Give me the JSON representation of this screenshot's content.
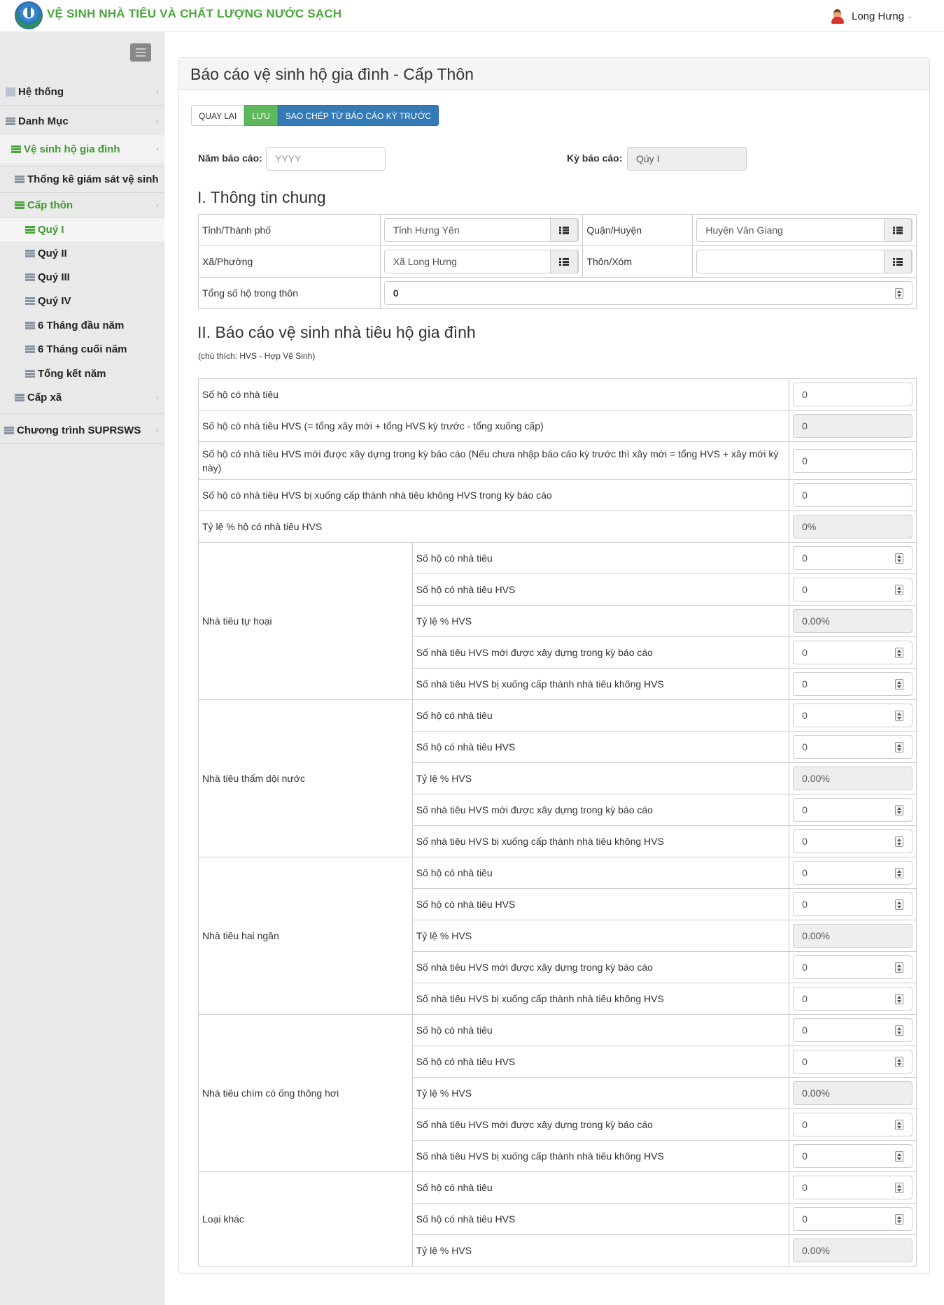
{
  "brand": {
    "title": "VỆ SINH NHÀ TIÊU VÀ CHẤT LƯỢNG NƯỚC SẠCH"
  },
  "user": {
    "name": "Long Hưng"
  },
  "sidebar": {
    "items": [
      {
        "label": "Hệ thống"
      },
      {
        "label": "Danh Mục"
      },
      {
        "label": "Vệ sinh hộ gia đình"
      },
      {
        "label": "Thống kê giám sát vệ sinh"
      },
      {
        "label": "Cấp thôn"
      },
      {
        "label": "Quý I"
      },
      {
        "label": "Quý II"
      },
      {
        "label": "Quý III"
      },
      {
        "label": "Quý IV"
      },
      {
        "label": "6 Tháng đầu năm"
      },
      {
        "label": "6 Tháng cuối năm"
      },
      {
        "label": "Tổng kết năm"
      },
      {
        "label": "Cấp xã"
      },
      {
        "label": "Chương trình SUPRSWS"
      }
    ]
  },
  "page": {
    "title": "Báo cáo vệ sinh hộ gia đình - Cấp Thôn"
  },
  "toolbar": {
    "back": "QUAY LẠI",
    "save": "LƯU",
    "copy": "SAO CHÉP TỪ BÁO CÁO KỲ TRƯỚC"
  },
  "form": {
    "year_label": "Năm báo cáo:",
    "year_placeholder": "YYYY",
    "period_label": "Kỳ báo cáo:",
    "period_value": "Qúy I"
  },
  "section1": {
    "title": "I. Thông tin chung",
    "province_label": "Tỉnh/Thành phố",
    "province_value": "Tỉnh Hưng Yên",
    "district_label": "Quận/Huyện",
    "district_value": "Huyện Văn Giang",
    "commune_label": "Xã/Phường",
    "commune_value": "Xã Long Hưng",
    "village_label": "Thôn/Xóm",
    "village_value": "",
    "households_label": "Tổng số hộ trong thôn",
    "households_value": "0"
  },
  "section2": {
    "title": "II. Báo cáo vệ sinh nhà tiêu hộ gia đình",
    "note": "(chú thích: HVS - Hợp Vệ Sinh)",
    "summary": [
      {
        "label": "Số hộ có nhà tiêu",
        "value": "0"
      },
      {
        "label": "Số hộ có nhà tiêu HVS (= tổng xây mới + tổng HVS kỳ trước - tổng xuống cấp)",
        "value": "0"
      },
      {
        "label": "Số hộ có nhà tiêu HVS mới được xây dựng trong kỳ báo cáo (Nếu chưa nhập báo cáo kỳ trước thì xây mới = tổng HVS + xây mới kỳ này)",
        "value": "0"
      },
      {
        "label": "Số hộ có nhà tiêu HVS bị xuống cấp thành nhà tiêu không HVS trong kỳ báo cáo",
        "value": "0"
      },
      {
        "label": "Tỷ lệ % hộ có nhà tiêu HVS",
        "value": "0%"
      }
    ],
    "groups": [
      {
        "name": "Nhà tiêu tự hoại",
        "rows": [
          {
            "label": "Số hộ có nhà tiêu",
            "value": "0"
          },
          {
            "label": "Số hộ có nhà tiêu HVS",
            "value": "0"
          },
          {
            "label": "Tỷ lệ % HVS",
            "value": "0.00%"
          },
          {
            "label": "Số nhà tiêu HVS mới được xây dựng trong kỳ báo cáo",
            "value": "0"
          },
          {
            "label": "Số nhà tiêu HVS bị xuống cấp thành nhà tiêu không HVS",
            "value": "0"
          }
        ]
      },
      {
        "name": "Nhà tiêu thấm dội nước",
        "rows": [
          {
            "label": "Số hộ có nhà tiêu",
            "value": "0"
          },
          {
            "label": "Số hộ có nhà tiêu HVS",
            "value": "0"
          },
          {
            "label": "Tỷ lệ % HVS",
            "value": "0.00%"
          },
          {
            "label": "Số nhà tiêu HVS mới được xây dựng trong kỳ báo cáo",
            "value": "0"
          },
          {
            "label": "Số nhà tiêu HVS bị xuống cấp thành nhà tiêu không HVS",
            "value": "0"
          }
        ]
      },
      {
        "name": "Nhà tiêu hai ngăn",
        "rows": [
          {
            "label": "Số hộ có nhà tiêu",
            "value": "0"
          },
          {
            "label": "Số hộ có nhà tiêu HVS",
            "value": "0"
          },
          {
            "label": "Tỷ lệ % HVS",
            "value": "0.00%"
          },
          {
            "label": "Số nhà tiêu HVS mới được xây dựng trong kỳ báo cáo",
            "value": "0"
          },
          {
            "label": "Số nhà tiêu HVS bị xuống cấp thành nhà tiêu không HVS",
            "value": "0"
          }
        ]
      },
      {
        "name": "Nhà tiêu chìm có ống thông hơi",
        "rows": [
          {
            "label": "Số hộ có nhà tiêu",
            "value": "0"
          },
          {
            "label": "Số hộ có nhà tiêu HVS",
            "value": "0"
          },
          {
            "label": "Tỷ lệ % HVS",
            "value": "0.00%"
          },
          {
            "label": "Số nhà tiêu HVS mới được xây dựng trong kỳ báo cáo",
            "value": "0"
          },
          {
            "label": "Số nhà tiêu HVS bị xuống cấp thành nhà tiêu không HVS",
            "value": "0"
          }
        ]
      },
      {
        "name": "Loại khác",
        "rows": [
          {
            "label": "Số hộ có nhà tiêu",
            "value": "0"
          },
          {
            "label": "Số hộ có nhà tiêu HVS",
            "value": "0"
          },
          {
            "label": "Tỷ lệ % HVS",
            "value": "0.00%"
          }
        ]
      }
    ]
  }
}
